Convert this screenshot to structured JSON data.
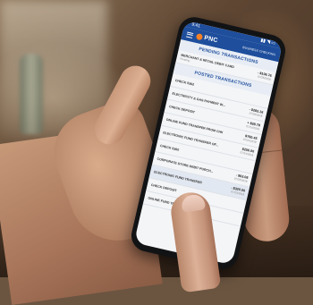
{
  "app": {
    "status_time": "9:41",
    "status_icons": "▮▮ ◥ ▭",
    "brand_name": "PNC",
    "screen_title": "BUSINESS CHECKING"
  },
  "pending": {
    "heading": "PENDING TRANSACTIONS",
    "items": [
      {
        "name": "MERCHANT & RETAIL DEBIT CARD",
        "sub": "Pending",
        "amount": "- $106.76",
        "date": "07/25/2018"
      }
    ]
  },
  "posted": {
    "heading": "POSTED TRANSACTIONS",
    "items": [
      {
        "name": "CHECK 5362",
        "sub": "",
        "amount": "",
        "date": ""
      },
      {
        "name": "ELECTRICITY & GAS PAYMENT W...",
        "sub": "",
        "amount": "- $283.16",
        "date": "07/25/2018"
      },
      {
        "name": "CHECK DEPOSIT",
        "sub": "",
        "amount": "+ $28.78",
        "date": "07/24/2018"
      },
      {
        "name": "ONLINE FUND TRANSFER FROM CHK",
        "sub": "",
        "amount": "$760.45",
        "date": "07/24/2018"
      },
      {
        "name": "ELECTRONIC FUND TRANSFER OF...",
        "sub": "",
        "amount": "$256.00",
        "date": "07/24/2018"
      },
      {
        "name": "CHECK 5360",
        "sub": "",
        "amount": "",
        "date": ""
      },
      {
        "name": "CORPORATE STORE DEBIT PURCH...",
        "sub": "",
        "amount": "- $63.08",
        "date": "07/23/2018"
      },
      {
        "name": "ELECTRONIC FUND TRANSFER",
        "sub": "",
        "amount": "- $320.00",
        "date": "07/23/2018"
      },
      {
        "name": "CHECK DEPOSIT",
        "sub": "",
        "amount": "",
        "date": ""
      },
      {
        "name": "ONLINE FUND TRANSFER",
        "sub": "",
        "amount": "",
        "date": ""
      }
    ]
  }
}
